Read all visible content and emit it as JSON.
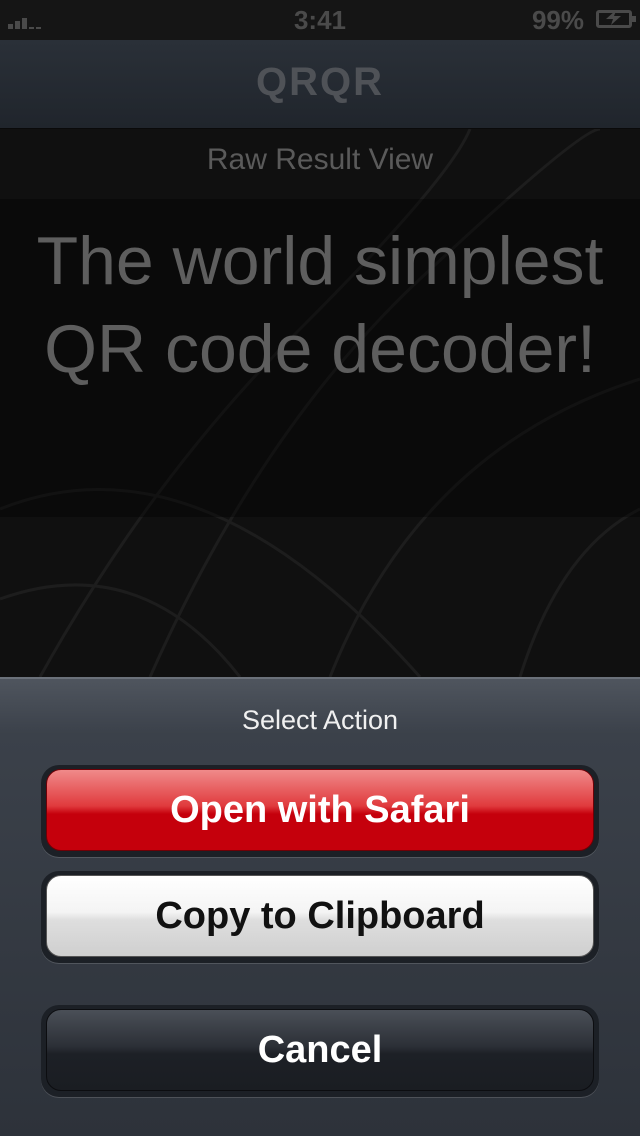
{
  "status_bar": {
    "time": "3:41",
    "battery_percent": "99%",
    "signal_bars_filled": 3,
    "signal_bars_total": 5,
    "battery_icon": "battery-charging-icon",
    "signal_icon": "signal-strength-icon"
  },
  "nav": {
    "title": "QRQR"
  },
  "content": {
    "subtitle": "Raw Result View",
    "result_line1": "The world simplest",
    "result_line2": "QR code decoder!"
  },
  "action_sheet": {
    "title": "Select Action",
    "open_safari_label": "Open with Safari",
    "copy_clipboard_label": "Copy to Clipboard",
    "cancel_label": "Cancel"
  },
  "colors": {
    "destructive": "#c5000c",
    "sheet_background": "#3b414a",
    "nav_background": "#2a3038"
  }
}
